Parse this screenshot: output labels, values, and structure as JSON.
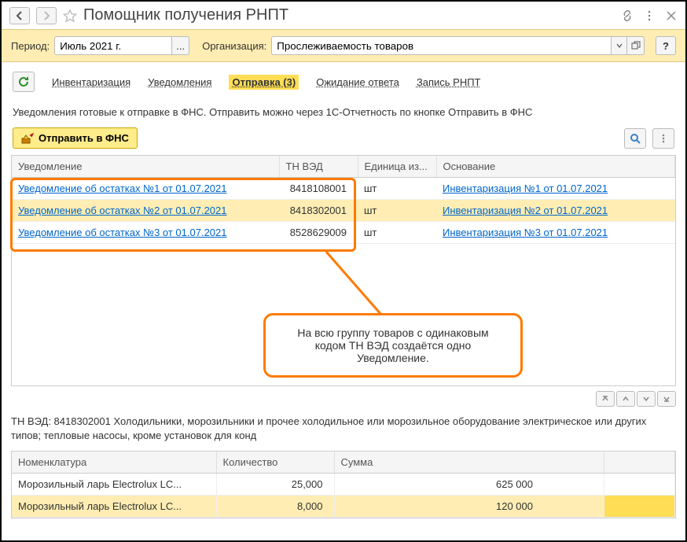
{
  "title": "Помощник получения РНПТ",
  "params": {
    "period_label": "Период:",
    "period_value": "Июль 2021 г.",
    "org_label": "Организация:",
    "org_value": "Прослеживаемость товаров",
    "help": "?"
  },
  "tabs": {
    "t0": "Инвентаризация",
    "t1": "Уведомления",
    "t2": "Отправка (3)",
    "t3": "Ожидание ответа",
    "t4": "Запись РНПТ"
  },
  "description": "Уведомления готовые к отправке в ФНС. Отправить можно через 1С-Отчетность по кнопке Отправить в ФНС",
  "send_button": "Отправить в ФНС",
  "table": {
    "headers": {
      "c0": "Уведомление",
      "c1": "ТН ВЭД",
      "c2": "Единица из...",
      "c3": "Основание"
    },
    "rows": [
      {
        "notice": "Уведомление об остатках №1 от 01.07.2021",
        "tnved": "8418108001",
        "unit": "шт",
        "basis": "Инвентаризация №1 от 01.07.2021"
      },
      {
        "notice": "Уведомление об остатках №2 от 01.07.2021",
        "tnved": "8418302001",
        "unit": "шт",
        "basis": "Инвентаризация №2 от 01.07.2021"
      },
      {
        "notice": "Уведомление об остатках №3 от 01.07.2021",
        "tnved": "8528629009",
        "unit": "шт",
        "basis": "Инвентаризация №3 от 01.07.2021"
      }
    ]
  },
  "callout": "На всю группу товаров с одинаковым кодом ТН ВЭД создаётся одно Уведомление.",
  "footer_desc": "ТН ВЭД: 8418302001 Холодильники, морозильники и прочее холодильное или морозильное оборудование электрическое или других типов; тепловые насосы, кроме установок для конд",
  "table2": {
    "headers": {
      "c0": "Номенклатура",
      "c1": "Количество",
      "c2": "Сумма"
    },
    "rows": [
      {
        "name": "Морозильный ларь Electrolux LC...",
        "qty": "25,000",
        "sum": "625 000"
      },
      {
        "name": "Морозильный ларь Electrolux LC...",
        "qty": "8,000",
        "sum": "120 000"
      }
    ]
  }
}
